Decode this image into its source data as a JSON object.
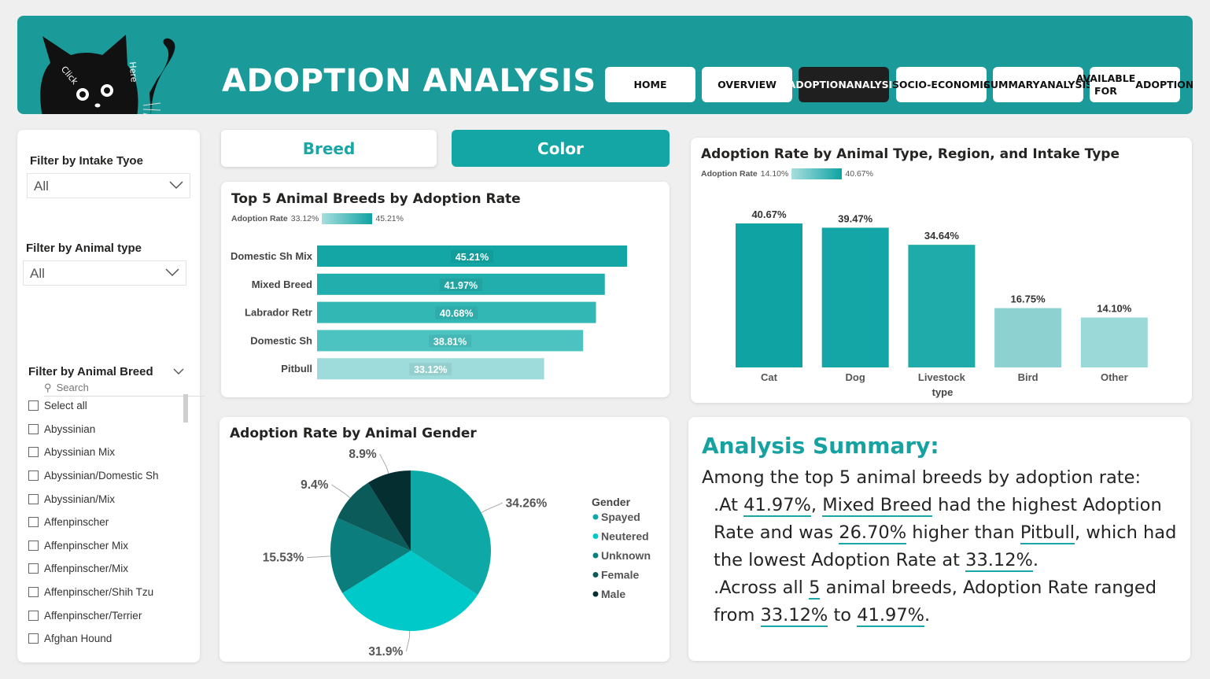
{
  "header": {
    "title": "ADOPTION ANALYSIS",
    "cat_text_1": "Click",
    "cat_text_2": "Here",
    "nav": [
      "HOME",
      "OVERVIEW",
      "ADOPTION ANALYSIS",
      "SOCIO-ECONOMIC",
      "SUMMARY ANALYSIS",
      "AVAILABLE FOR ADOPTION"
    ],
    "nav_lines": [
      [
        "HOME"
      ],
      [
        "OVERVIEW"
      ],
      [
        "ADOPTION",
        "ANALYSIS"
      ],
      [
        "SOCIO-",
        "ECONOMIC"
      ],
      [
        "SUMMARY",
        "ANALYSIS"
      ],
      [
        "AVAILABLE FOR",
        "ADOPTION"
      ]
    ],
    "active_nav": "ADOPTION ANALYSIS",
    "color": "#1b9a9a"
  },
  "filters": {
    "intake_label": "Filter by Intake Tyoe",
    "intake_value": "All",
    "animal_label": "Filter by Animal type",
    "animal_value": "All",
    "breed_label": "Filter by Animal Breed",
    "search_placeholder": "Search",
    "breeds": [
      "Select all",
      "Abyssinian",
      "Abyssinian Mix",
      "Abyssinian/Domestic Sh",
      "Abyssinian/Mix",
      "Affenpinscher",
      "Affenpinscher Mix",
      "Affenpinscher/Mix",
      "Affenpinscher/Shih Tzu",
      "Affenpinscher/Terrier",
      "Afghan Hound"
    ]
  },
  "toggles": {
    "breed": "Breed",
    "color": "Color"
  },
  "breed_chart": {
    "title": "Top 5 Animal Breeds by Adoption Rate",
    "legend_label": "Adoption Rate",
    "legend_min": "33.12%",
    "legend_max": "45.21%"
  },
  "region_chart": {
    "title": "Adoption Rate by Animal Type, Region, and Intake Type",
    "legend_label": "Adoption Rate",
    "legend_min": "14.10%",
    "legend_max": "40.67%",
    "xlabel": "type"
  },
  "gender_chart": {
    "title": "Adoption Rate by Animal Gender",
    "legend_title": "Gender"
  },
  "summary": {
    "title": "Analysis Summary:",
    "intro": "Among the top 5 animal breeds by adoption rate:",
    "b1_p1": ".At ",
    "b1_v1": "41.97%",
    "b1_p2": ", ",
    "b1_v2": "Mixed Breed",
    "b1_p3": " had the highest Adoption Rate and was ",
    "b1_v3": "26.70%",
    "b1_p4": " higher than ",
    "b1_v4": "Pitbull",
    "b1_p5": ", which had the lowest Adoption Rate at ",
    "b1_v5": "33.12%",
    "b1_p6": ".",
    "b2_p1": ".Across all ",
    "b2_v1": "5",
    "b2_p2": " animal breeds, Adoption Rate ranged from ",
    "b2_v2": "33.12%",
    "b2_p3": " to ",
    "b2_v3": "41.97%",
    "b2_p4": "."
  },
  "chart_data": [
    {
      "type": "bar",
      "orientation": "horizontal",
      "title": "Top 5 Animal Breeds by Adoption Rate",
      "categories": [
        "Domestic Sh Mix",
        "Mixed Breed",
        "Labrador Retr",
        "Domestic Sh",
        "Pitbull"
      ],
      "values": [
        45.21,
        41.97,
        40.68,
        38.81,
        33.12
      ],
      "labels": [
        "45.21%",
        "41.97%",
        "40.68%",
        "38.81%",
        "33.12%"
      ],
      "colors": [
        "#14a6a4",
        "#22aeac",
        "#32b7b5",
        "#4cc3c1",
        "#9edcdb"
      ],
      "xlim": [
        0,
        50
      ]
    },
    {
      "type": "bar",
      "title": "Adoption Rate by Animal Type, Region, and Intake Type",
      "categories": [
        "Cat",
        "Dog",
        "Livestock",
        "Bird",
        "Other"
      ],
      "values": [
        40.67,
        39.47,
        34.64,
        16.75,
        14.1
      ],
      "labels": [
        "40.67%",
        "39.47%",
        "34.64%",
        "16.75%",
        "14.10%"
      ],
      "colors": [
        "#0fa3a3",
        "#14a6a6",
        "#20abab",
        "#8dd1d1",
        "#9bd8d8"
      ],
      "xlabel": "type",
      "ylim": [
        0,
        45
      ]
    },
    {
      "type": "pie",
      "title": "Adoption Rate by Animal Gender",
      "categories": [
        "Spayed",
        "Neutered",
        "Unknown",
        "Female",
        "Male"
      ],
      "values": [
        34.26,
        31.9,
        15.53,
        9.4,
        8.9
      ],
      "labels": [
        "34.26%",
        "31.9%",
        "15.53%",
        "9.4%",
        "8.9%"
      ],
      "colors": [
        "#0ea8a6",
        "#00c9c9",
        "#0b7d7d",
        "#0b5b5b",
        "#052e30"
      ]
    }
  ]
}
